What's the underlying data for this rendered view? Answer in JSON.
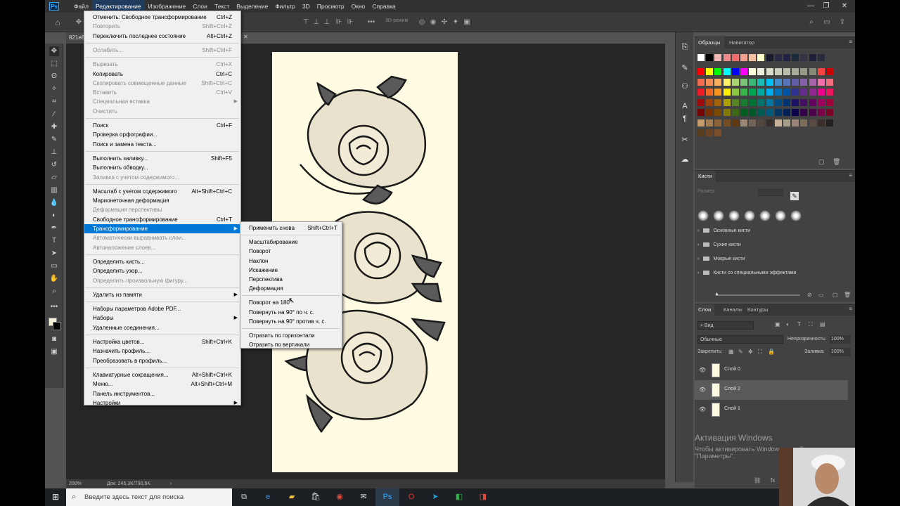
{
  "app": {
    "logo": "Ps"
  },
  "menubar": {
    "items": [
      "Файл",
      "Редактирование",
      "Изображение",
      "Слои",
      "Текст",
      "Выделение",
      "Фильтр",
      "3D",
      "Просмотр",
      "Окно",
      "Справка"
    ],
    "active_index": 1
  },
  "window_controls": {
    "minimize": "—",
    "restore": "❐",
    "close": "✕"
  },
  "options_bar": {
    "mode_3d": "3D-режим"
  },
  "doc_tab": {
    "name": "821e8"
  },
  "edit_menu": {
    "items": [
      {
        "label": "Отменить: Свободное трансформирование",
        "shortcut": "Ctrl+Z",
        "disabled": false
      },
      {
        "label": "Повторить",
        "shortcut": "Shift+Ctrl+Z",
        "disabled": true
      },
      {
        "label": "Переключить последнее состояние",
        "shortcut": "Alt+Ctrl+Z",
        "disabled": false
      },
      {
        "label": "Ослабить...",
        "shortcut": "Shift+Ctrl+F",
        "disabled": true
      },
      {
        "label": "Вырезать",
        "shortcut": "Ctrl+X",
        "disabled": true
      },
      {
        "label": "Копировать",
        "shortcut": "Ctrl+C",
        "disabled": false
      },
      {
        "label": "Скопировать совмещенные данные",
        "shortcut": "Shift+Ctrl+C",
        "disabled": true
      },
      {
        "label": "Вставить",
        "shortcut": "Ctrl+V",
        "disabled": true
      },
      {
        "label": "Специальная вставка",
        "shortcut": "",
        "disabled": true,
        "submenu": true
      },
      {
        "label": "Очистить",
        "shortcut": "",
        "disabled": true
      },
      {
        "label": "Поиск",
        "shortcut": "Ctrl+F",
        "disabled": false
      },
      {
        "label": "Проверка орфографии...",
        "shortcut": "",
        "disabled": false
      },
      {
        "label": "Поиск и замена текста...",
        "shortcut": "",
        "disabled": false
      },
      {
        "label": "Выполнить заливку...",
        "shortcut": "Shift+F5",
        "disabled": false
      },
      {
        "label": "Выполнить обводку...",
        "shortcut": "",
        "disabled": false
      },
      {
        "label": "Заливка с учетом содержимого...",
        "shortcut": "",
        "disabled": true
      },
      {
        "label": "Масштаб с учетом содержимого",
        "shortcut": "Alt+Shift+Ctrl+C",
        "disabled": false
      },
      {
        "label": "Марионеточная деформация",
        "shortcut": "",
        "disabled": false
      },
      {
        "label": "Деформация перспективы",
        "shortcut": "",
        "disabled": true
      },
      {
        "label": "Свободное трансформирование",
        "shortcut": "Ctrl+T",
        "disabled": false
      },
      {
        "label": "Трансформирование",
        "shortcut": "",
        "disabled": false,
        "submenu": true,
        "highlight": true
      },
      {
        "label": "Автоматически выравнивать слои...",
        "shortcut": "",
        "disabled": true
      },
      {
        "label": "Автоналожение слоев...",
        "shortcut": "",
        "disabled": true
      },
      {
        "label": "Определить кисть...",
        "shortcut": "",
        "disabled": false
      },
      {
        "label": "Определить узор...",
        "shortcut": "",
        "disabled": false
      },
      {
        "label": "Определить произвольную фигуру...",
        "shortcut": "",
        "disabled": true
      },
      {
        "label": "Удалить из памяти",
        "shortcut": "",
        "disabled": false,
        "submenu": true
      },
      {
        "label": "Наборы параметров Adobe PDF...",
        "shortcut": "",
        "disabled": false
      },
      {
        "label": "Наборы",
        "shortcut": "",
        "disabled": false,
        "submenu": true
      },
      {
        "label": "Удаленные соединения...",
        "shortcut": "",
        "disabled": false
      },
      {
        "label": "Настройка цветов...",
        "shortcut": "Shift+Ctrl+K",
        "disabled": false
      },
      {
        "label": "Назначить профиль...",
        "shortcut": "",
        "disabled": false
      },
      {
        "label": "Преобразовать в профиль...",
        "shortcut": "",
        "disabled": false
      },
      {
        "label": "Клавиатурные сокращения...",
        "shortcut": "Alt+Shift+Ctrl+K",
        "disabled": false
      },
      {
        "label": "Меню...",
        "shortcut": "Alt+Shift+Ctrl+M",
        "disabled": false
      },
      {
        "label": "Панель инструментов...",
        "shortcut": "",
        "disabled": false
      },
      {
        "label": "Настройки",
        "shortcut": "",
        "disabled": false,
        "submenu": true
      }
    ]
  },
  "transform_submenu": {
    "items": [
      {
        "label": "Применить снова",
        "shortcut": "Shift+Ctrl+T"
      },
      {
        "label": "Масштабирование",
        "shortcut": ""
      },
      {
        "label": "Поворот",
        "shortcut": ""
      },
      {
        "label": "Наклон",
        "shortcut": ""
      },
      {
        "label": "Искажение",
        "shortcut": ""
      },
      {
        "label": "Перспектива",
        "shortcut": ""
      },
      {
        "label": "Деформация",
        "shortcut": ""
      },
      {
        "label": "Поворот на 180°",
        "shortcut": ""
      },
      {
        "label": "Повернуть на 90° по ч. с.",
        "shortcut": ""
      },
      {
        "label": "Повернуть на 90° против ч. с.",
        "shortcut": ""
      },
      {
        "label": "Отразить по горизонтали",
        "shortcut": ""
      },
      {
        "label": "Отразить по вертикали",
        "shortcut": ""
      }
    ]
  },
  "status": {
    "zoom": "200%",
    "doc": "Док: 245,3K/790,6K"
  },
  "swatches_panel": {
    "tabs": [
      "Образцы",
      "Навигатор"
    ],
    "colors_row1": [
      "#ffffff",
      "#000000",
      "#f2b8b8",
      "#f08a8a",
      "#ee6e6e",
      "#f1a091",
      "#f7c0a0",
      "#ffffcc",
      "#1a1a2e",
      "#2a2a44",
      "#222244",
      "#1a2a3a",
      "#333344",
      "#20203a",
      "#2a2a3f"
    ],
    "colors_grid": [
      [
        "#ff0000",
        "#ffff00",
        "#00ff00",
        "#00ffff",
        "#0000ff",
        "#ff00ff",
        "#ffffe0",
        "#eeeedd",
        "#ddddcc",
        "#ccccbb",
        "#bbbbaa",
        "#aaaa99",
        "#999988",
        "#888877",
        "#ff4444",
        "#cc0000"
      ],
      [
        "#f26c4f",
        "#f68e56",
        "#fbaf5c",
        "#fff467",
        "#acd372",
        "#7cc576",
        "#3bb878",
        "#1abbb4",
        "#00bff3",
        "#438ccb",
        "#5574b9",
        "#605ca8",
        "#855fa8",
        "#a763a8",
        "#f06ea9",
        "#f26d7d"
      ],
      [
        "#ed1c24",
        "#f26522",
        "#f7941d",
        "#fff200",
        "#8dc73f",
        "#39b54a",
        "#00a651",
        "#00a99d",
        "#00aeef",
        "#0072bc",
        "#0054a6",
        "#2e3192",
        "#662d91",
        "#92278f",
        "#ec008c",
        "#ed145b"
      ],
      [
        "#9e0b0f",
        "#a0410d",
        "#a36209",
        "#aba000",
        "#598527",
        "#1a7b30",
        "#007236",
        "#00746b",
        "#0076a3",
        "#004b80",
        "#003471",
        "#1b1464",
        "#440e62",
        "#630460",
        "#9e005d",
        "#9e0039"
      ],
      [
        "#790000",
        "#7b2e00",
        "#7d4900",
        "#827b00",
        "#406618",
        "#005e20",
        "#005826",
        "#005952",
        "#005b7f",
        "#003663",
        "#002157",
        "#0d004c",
        "#32004b",
        "#4b0049",
        "#7b0046",
        "#7a0026"
      ],
      [
        "#c69c6d",
        "#a67c52",
        "#8c6239",
        "#754c24",
        "#603913",
        "#998675",
        "#736357",
        "#534741",
        "#362f2d",
        "#c7b299",
        "#a59f89",
        "#9b8579",
        "#7d6e5a",
        "#594a42",
        "#3c2e28",
        "#231f20"
      ],
      [
        "#5a3e1b",
        "#6b4423",
        "#7c4d2b"
      ]
    ]
  },
  "brushes_panel": {
    "tabs": [
      "Кисти"
    ],
    "size_label": "Размер:",
    "folders": [
      "Основные кисти",
      "Сухие кисти",
      "Мокрые кисти",
      "Кисти со специальными эффектами"
    ]
  },
  "layers_panel": {
    "tabs": [
      "Слои",
      "Каналы",
      "Контуры"
    ],
    "filter": "Вид",
    "blend_mode": "Обычные",
    "opacity_label": "Непрозрачность:",
    "opacity_value": "100%",
    "lock_label": "Закрепить:",
    "fill_label": "Заливка:",
    "fill_value": "100%",
    "layers": [
      {
        "name": "Слой 0",
        "selected": false
      },
      {
        "name": "Слой 2",
        "selected": true
      },
      {
        "name": "Слой 1",
        "selected": false
      }
    ]
  },
  "activation": {
    "title": "Активация Windows",
    "line1": "Чтобы активировать Windows, перейд",
    "line2": "\"Параметры\"."
  },
  "taskbar": {
    "search_placeholder": "Введите здесь текст для поиска"
  }
}
